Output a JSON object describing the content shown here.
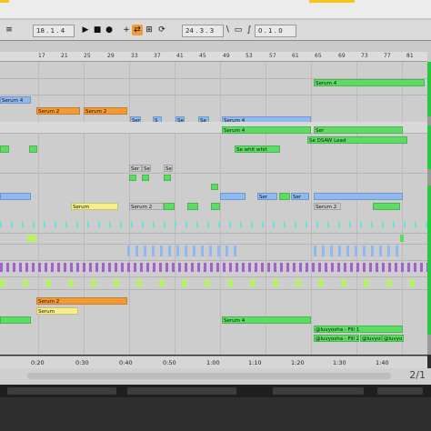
{
  "transport": {
    "position": "18 . 1 . 4",
    "loop_start": "24 . 3 . 3",
    "loop_length": "0 . 1 . 0"
  },
  "ruler": {
    "bars": [
      "17",
      "21",
      "25",
      "29",
      "33",
      "37",
      "41",
      "45",
      "49",
      "53",
      "57",
      "61",
      "65",
      "69",
      "73",
      "77",
      "81"
    ]
  },
  "timeline": {
    "labels": [
      "0:20",
      "0:30",
      "0:40",
      "0:50",
      "1:00",
      "1:10",
      "1:20",
      "1:30",
      "1:40"
    ]
  },
  "page_indicator": "2/1",
  "clip_colors": {
    "green": "#5ddc63",
    "lightgreen": "#9ee89f",
    "blue": "#8fb9f0",
    "orange": "#f39a36",
    "yellow": "#f6ee8a",
    "grey": "#c8c8c8",
    "purple": "#a45fd0",
    "cyan": "#63e6d8",
    "lime": "#b8f06a",
    "white": "#f1f1f1"
  },
  "clips": {
    "serum4_a": "Serum 4",
    "serum2_a": "Serum 2",
    "serum2_b": "Serum 2",
    "ser": "Ser",
    "s": "S",
    "se": "Se",
    "ser_top_1": "Ser",
    "se_top_2": "Se",
    "serum4_top": "Serum 4",
    "serum4_top2": "Serum 4",
    "serum4_mid": "Serum 4",
    "se_dsaw": "Se DSAW Lead",
    "se_whit": "Se whit whit",
    "serum_yellow": "Serum",
    "serum2_grey": "Serum 2",
    "serum2_grey2": "Serum 2",
    "serum_bottom": "Serum",
    "serum2_orange": "Serum 2",
    "luv_fill1": "@luvyosha - Fill 1",
    "luv_fill2": "@luvyosha - Fill 2",
    "luv_a": "@luvyosha",
    "luv_b": "@luvyo",
    "serum4_row13": "Serum 4",
    "serum4_row13b": "Serum 4",
    "ser_grey": "Ser",
    "se_grey": "Se",
    "se_grey2": "Se",
    "ser_r6": "Ser",
    "ser_r6b": "Ser"
  }
}
